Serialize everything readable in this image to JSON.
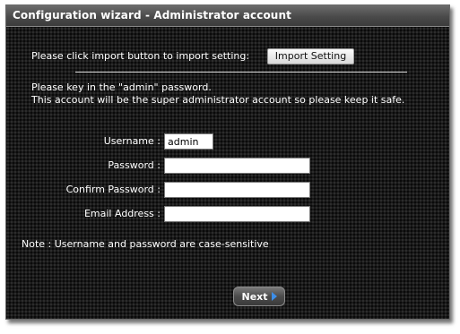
{
  "dialog": {
    "title": "Configuration wizard - Administrator account"
  },
  "import": {
    "prompt": "Please click import button to import setting:",
    "button_label": "Import Setting"
  },
  "instructions": {
    "line1": "Please key in the \"admin\" password.",
    "line2": "This account will be the super administrator account so please keep it safe."
  },
  "form": {
    "username": {
      "label": "Username :",
      "value": "admin"
    },
    "password": {
      "label": "Password :",
      "value": ""
    },
    "confirm_password": {
      "label": "Confirm Password :",
      "value": ""
    },
    "email": {
      "label": "Email Address :",
      "value": ""
    }
  },
  "note": "Note : Username and password are case-sensitive",
  "next_button": {
    "label": "Next",
    "icon": "arrow-right-icon",
    "icon_color": "#3d8ee8"
  }
}
